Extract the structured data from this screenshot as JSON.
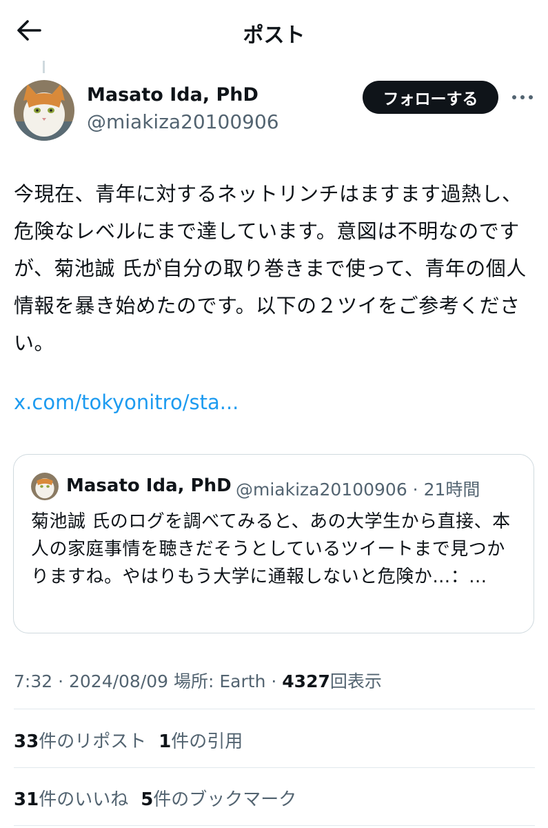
{
  "header": {
    "title": "ポスト",
    "back_icon": "arrow-left-icon"
  },
  "author": {
    "name": "Masato Ida, PhD",
    "handle": "@miakiza20100906",
    "follow_label": "フォローする",
    "more_icon": "more-horizontal-icon"
  },
  "post": {
    "text": "今現在、青年に対するネットリンチはますます過熱し、危険なレベルにまで達しています。意図は不明なのですが、菊池誠 氏が自分の取り巻きまで使って、青年の個人情報を暴き始めたのです。以下の２ツイをご参考ください。",
    "link": "x.com/tokyonitro/sta..."
  },
  "quote": {
    "name": "Masato Ida, PhD",
    "handle_time": "@miakiza20100906 · 21時間",
    "text": "菊池誠 氏のログを調べてみると、あの大学生から直接、本人の家庭事情を聴きだそうとしているツイートまで見つかりますね。やはりもう大学に通報しないと危険か…：..."
  },
  "meta": {
    "time_date_place": "7:32 · 2024/08/09 場所: Earth · ",
    "views": "4327",
    "views_label": "回表示"
  },
  "stats": {
    "reposts_count": "33",
    "reposts_label": "件のリポスト",
    "quotes_count": "1",
    "quotes_label": "件の引用",
    "likes_count": "31",
    "likes_label": "件のいいね",
    "bookmarks_count": "5",
    "bookmarks_label": "件のブックマーク"
  },
  "colors": {
    "link": "#1d9bf0",
    "secondary_text": "#536471",
    "primary_text": "#0f1419"
  }
}
